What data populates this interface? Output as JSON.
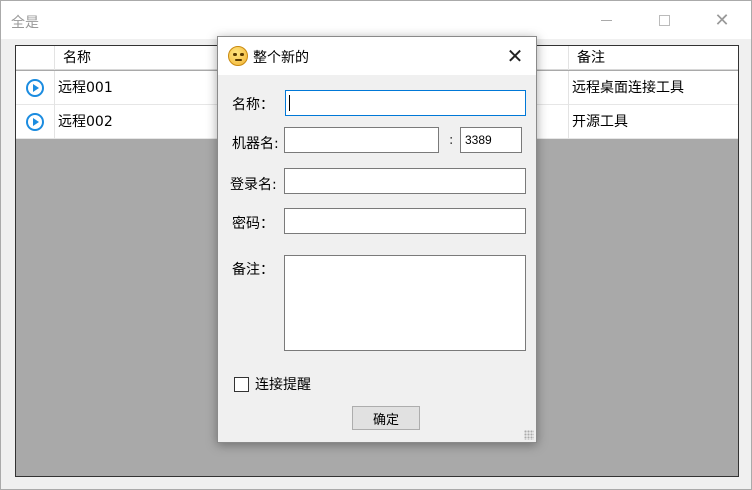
{
  "window": {
    "title": "全是"
  },
  "table": {
    "headers": {
      "name": "名称",
      "note": "备注"
    },
    "rows": [
      {
        "icon": "play-circle-icon",
        "name": "远程001",
        "note": "远程桌面连接工具"
      },
      {
        "icon": "play-circle-icon",
        "name": "远程002",
        "note": "开源工具"
      }
    ]
  },
  "dialog": {
    "icon": "emoji-face-icon",
    "title": "整个新的",
    "close_symbol": "✕",
    "name_label": "名称：",
    "name_value": "",
    "machine_label": "机器名:",
    "machine_value": "",
    "port_colon": ":",
    "port_value": "3389",
    "login_label": "登录名:",
    "login_value": "",
    "password_label": "密码：",
    "password_value": "",
    "note_label": "备注：",
    "note_value": "",
    "remind_label": "连接提醒",
    "remind_checked": false,
    "ok_label": "确定"
  },
  "colors": {
    "accent": "#0078d7",
    "list_bg": "#a9a9a9",
    "play_icon": "#1b8ce0"
  }
}
